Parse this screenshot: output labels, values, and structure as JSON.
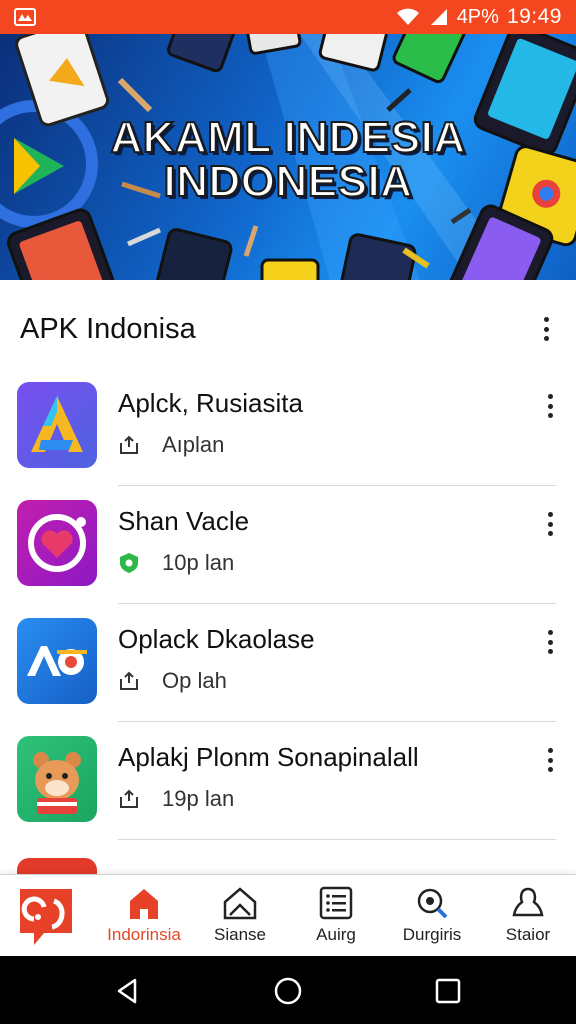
{
  "status_bar": {
    "battery": "4P%",
    "time": "19:49"
  },
  "banner": {
    "title_line1": "AKAML INDESIA",
    "title_line2": "INDONESIA"
  },
  "section": {
    "title": "APK Indonisa"
  },
  "apps": [
    {
      "name": "Aplck, Rusiasita",
      "meta": "Aıplan",
      "meta_icon": "share-icon"
    },
    {
      "name": "Shan Vacle",
      "meta": "10p lan",
      "meta_icon": "shield-icon"
    },
    {
      "name": "Oplack Dkaolase",
      "meta": "Op lah",
      "meta_icon": "share-icon"
    },
    {
      "name": "Aplakj Plonm Sonapinalall",
      "meta": "19p lan",
      "meta_icon": "share-icon"
    }
  ],
  "bottom_nav": [
    {
      "label": "Indorinsia",
      "icon": "home-icon",
      "active": true
    },
    {
      "label": "Sianse",
      "icon": "house-outline-icon",
      "active": false
    },
    {
      "label": "Auirg",
      "icon": "list-icon",
      "active": false
    },
    {
      "label": "Durgiris",
      "icon": "search-icon",
      "active": false
    },
    {
      "label": "Staior",
      "icon": "profile-icon",
      "active": false
    }
  ],
  "colors": {
    "accent": "#f4471f",
    "nav_active": "#e24a25"
  }
}
